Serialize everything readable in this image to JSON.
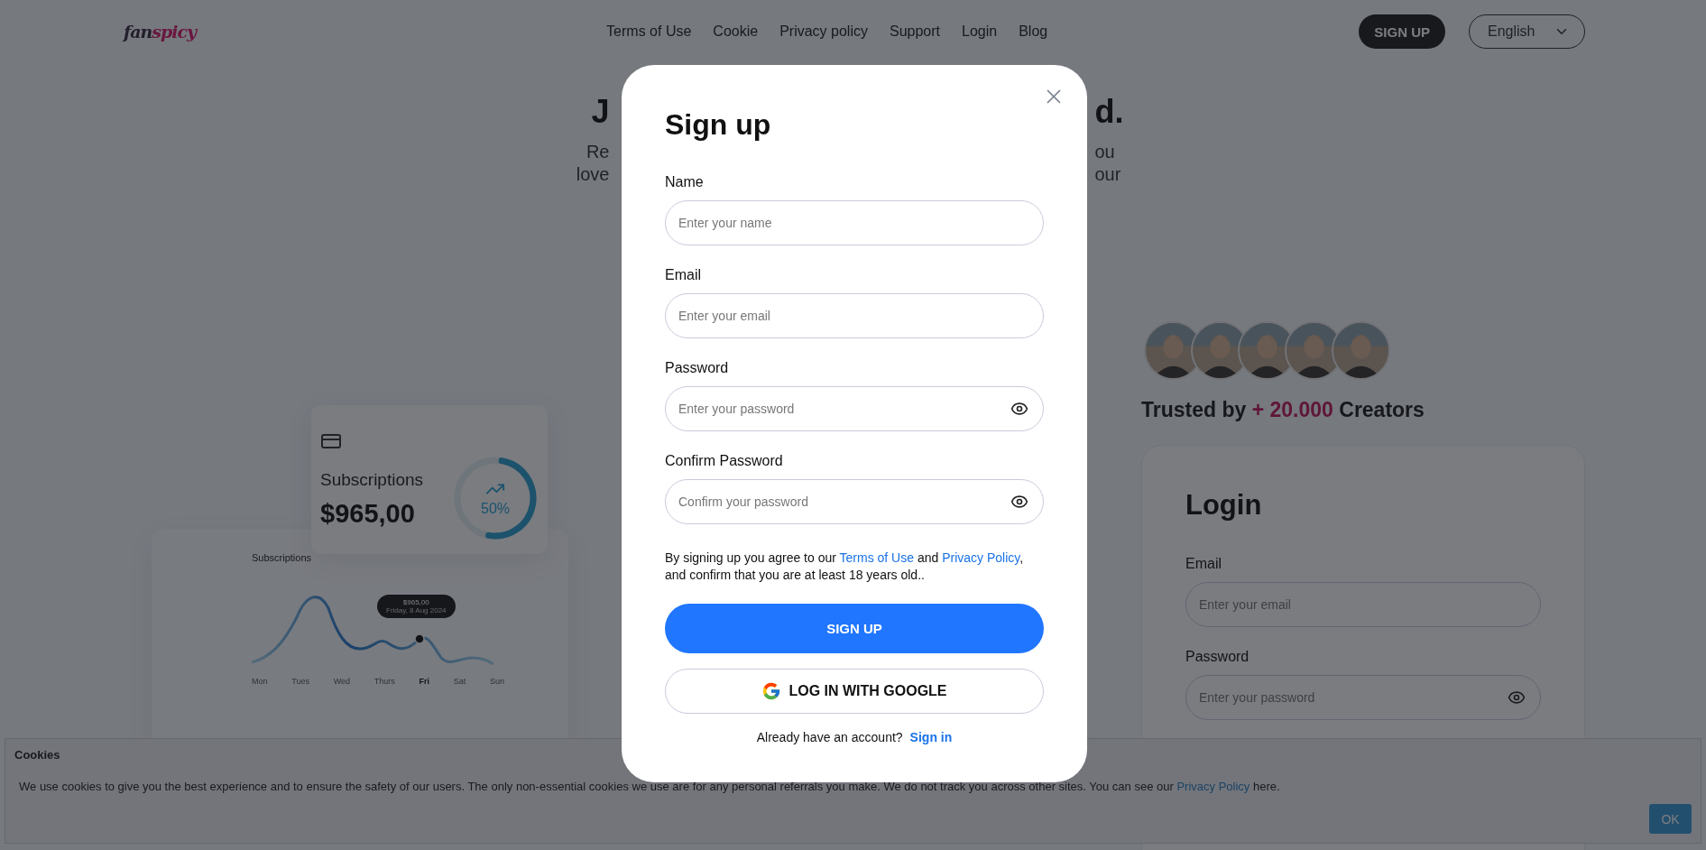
{
  "header": {
    "logo": {
      "first": "fan",
      "second": "spicy"
    },
    "nav": [
      "Terms of Use",
      "Cookie",
      "Privacy policy",
      "Support",
      "Login",
      "Blog"
    ],
    "signup_button": "SIGN UP",
    "language": "English"
  },
  "hero": {
    "headline_left": "J",
    "headline_right": "d.",
    "lines": [
      {
        "left": "Re",
        "right": "ou"
      },
      {
        "left": "love",
        "right": "our"
      }
    ]
  },
  "stats_card": {
    "title": "Subscriptions",
    "amount": "$965,00",
    "percent": "50%",
    "level": 0.5
  },
  "chart_card": {
    "title": "Subscriptions",
    "tooltip": {
      "value": "$965,00",
      "date": "Friday, 8 Aug 2024"
    },
    "days": [
      {
        "label": "Mon",
        "selected": false
      },
      {
        "label": "Tues",
        "selected": false
      },
      {
        "label": "Wed",
        "selected": false
      },
      {
        "label": "Thurs",
        "selected": false
      },
      {
        "label": "Fri",
        "selected": true
      },
      {
        "label": "Sat",
        "selected": false
      },
      {
        "label": "Sun",
        "selected": false
      }
    ]
  },
  "trusted": {
    "prefix": "Trusted by",
    "count": "+ 20.000",
    "suffix": "Creators"
  },
  "login_card": {
    "title": "Login",
    "fields": [
      {
        "kind": "text",
        "label": "Email",
        "placeholder": "Enter your email"
      },
      {
        "kind": "password",
        "label": "Password",
        "placeholder": "Enter your password"
      }
    ]
  },
  "modal": {
    "title": "Sign up",
    "fields": [
      {
        "kind": "text",
        "label": "Name",
        "placeholder": "Enter your name"
      },
      {
        "kind": "text",
        "label": "Email",
        "placeholder": "Enter your email"
      },
      {
        "kind": "password",
        "label": "Password",
        "placeholder": "Enter your password"
      },
      {
        "kind": "password",
        "label": "Confirm Password",
        "placeholder": "Confirm your password"
      }
    ],
    "consent": {
      "before": "By signing up you agree to our",
      "terms_link": "Terms of Use",
      "middle": "and",
      "privacy_link": "Privacy Policy",
      "after": ", and confirm that you are at least 18 years old.."
    },
    "signup_button": "SIGN UP",
    "google_button": "LOG IN WITH GOOGLE",
    "signin_prompt": "Already have an account?",
    "signin_link": "Sign in"
  },
  "cookie_bar": {
    "title": "Cookies",
    "text": "We use cookies to give you the best experience and to ensure the safety of our users. The only non-essential cookies we use are for any personal referrals you make. We do not track you across other sites. You can see our",
    "link": "Privacy Policy",
    "after": "here.",
    "ok_button": "OK"
  }
}
